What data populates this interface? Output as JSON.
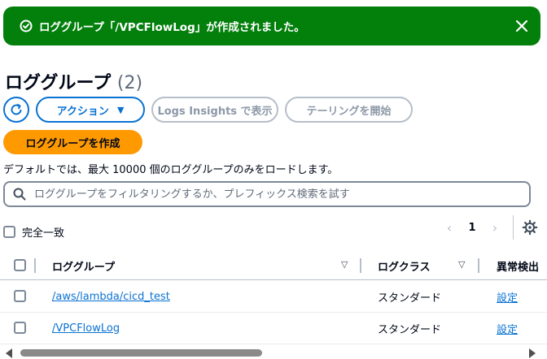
{
  "flash": {
    "message": "ロググループ「/VPCFlowLog」が作成されました。",
    "icon": "success-check-icon",
    "close_icon": "close-icon",
    "color": "#037f0c"
  },
  "header": {
    "title": "ロググループ",
    "count": "(2)"
  },
  "actions": {
    "refresh_icon": "refresh-icon",
    "action_menu": "アクション",
    "logs_insights": "Logs Insights で表示",
    "start_tail": "テーリングを開始",
    "create": "ロググループを作成"
  },
  "hint": "デフォルトでは、最大 10000 個のロググループのみをロードします。",
  "search": {
    "placeholder": "ロググループをフィルタリングするか、プレフィックス検索を試す"
  },
  "exact_match": {
    "label": "完全一致",
    "checked": false
  },
  "pagination": {
    "current_page": "1"
  },
  "table": {
    "columns": [
      "ロググループ",
      "ログクラス",
      "異常検出"
    ],
    "rows": [
      {
        "name": "/aws/lambda/cicd_test",
        "class": "スタンダード",
        "anomaly": "設定"
      },
      {
        "name": "/VPCFlowLog",
        "class": "スタンダード",
        "anomaly": "設定"
      }
    ]
  },
  "colors": {
    "accent": "#0972d3",
    "primary": "#ff9900"
  }
}
